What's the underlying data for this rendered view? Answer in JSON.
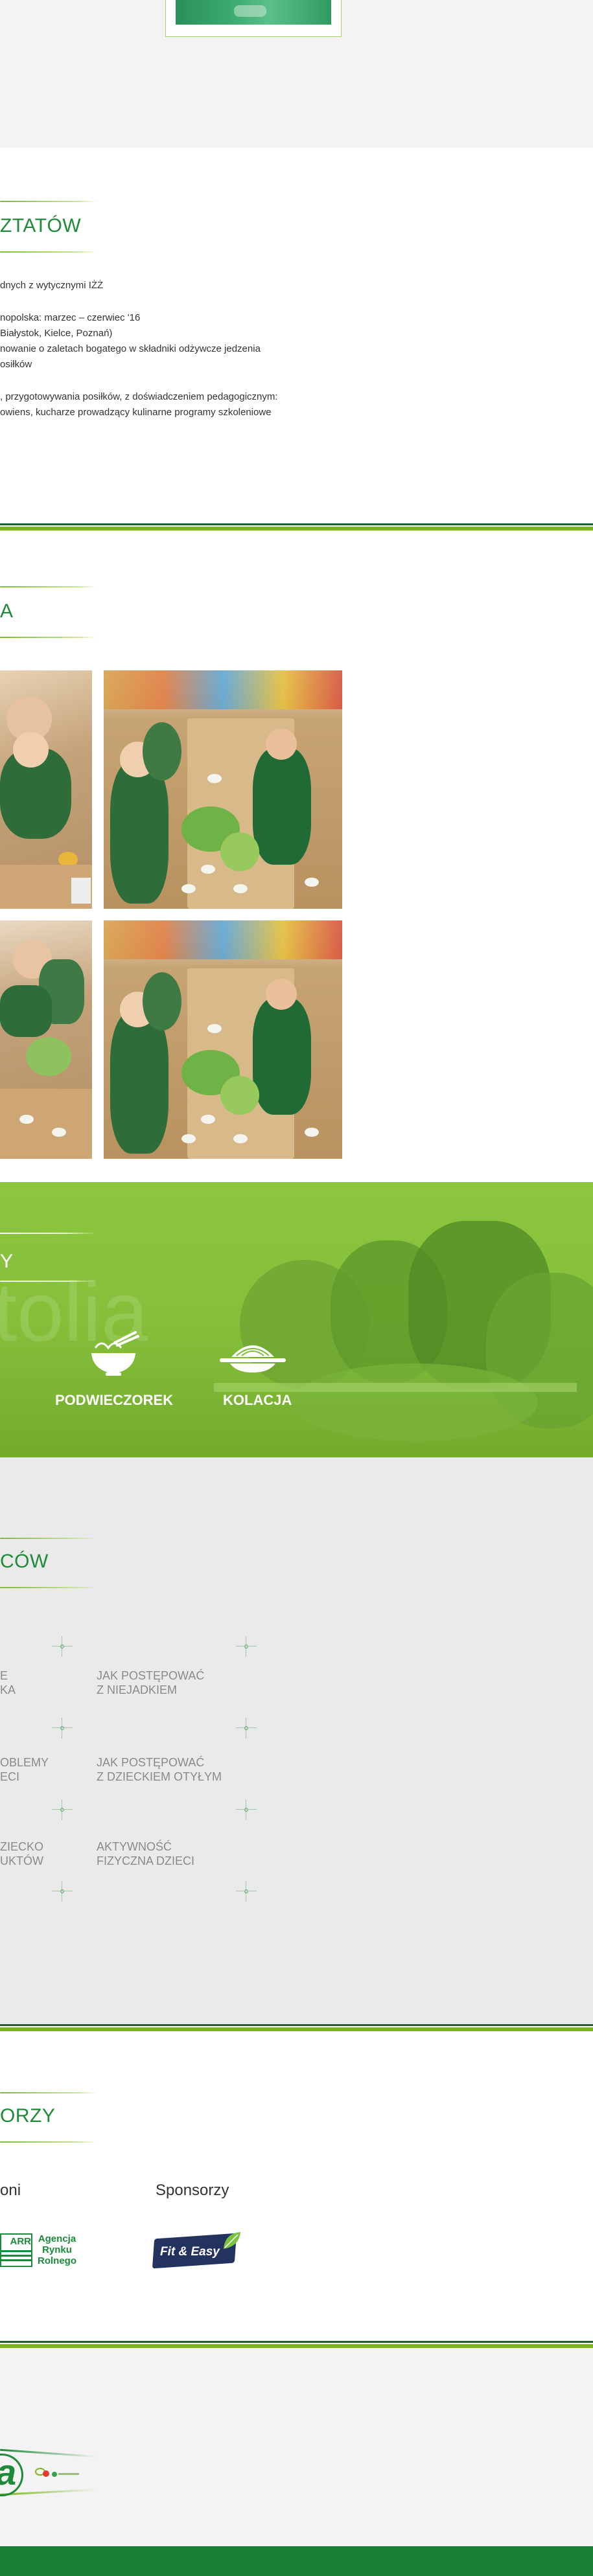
{
  "workshops": {
    "title": "ZTATÓW",
    "lines": [
      "dnych z wytycznymi IŻŻ",
      "nopolska: marzec – czerwiec '16",
      "Białystok, Kielce, Poznań)",
      "nowanie o zaletach bogatego w składniki odżywcze jedzenia",
      "osiłków",
      ", przygotowywania posiłków, z doświadczeniem pedagogicznym:",
      "owiens, kucharze prowadzący kulinarne programy szkoleniowe"
    ]
  },
  "gallery": {
    "title": "A"
  },
  "meals": {
    "title": "Y",
    "watermark": "tolia",
    "items": [
      {
        "label": "PODWIECZOREK",
        "icon": "bowl-noodles-icon"
      },
      {
        "label": "KOLACJA",
        "icon": "plate-spaghetti-icon"
      }
    ]
  },
  "parents": {
    "title": "CÓW",
    "items": [
      {
        "line1": "E",
        "line2": "KA"
      },
      {
        "line1": "JAK POSTĘPOWAĆ",
        "line2": "Z NIEJADKIEM"
      },
      {
        "line1": "OBLEMY",
        "line2": "ECI"
      },
      {
        "line1": "JAK POSTĘPOWAĆ",
        "line2": "Z DZIECKIEM OTYŁYM"
      },
      {
        "line1": "ZIECKO",
        "line2": "UKTÓW"
      },
      {
        "line1": "AKTYWNOŚĆ",
        "line2": "FIZYCZNA DZIECI"
      }
    ]
  },
  "partners": {
    "title": "ORZY",
    "patrons_heading": "oni",
    "sponsors_heading": "Sponsorzy",
    "arr_logo_text": "ARR",
    "arr_name_lines": [
      "Agencja",
      "Rynku",
      "Rolnego"
    ],
    "sponsor_logo_text": "Fit & Easy"
  },
  "footer": {
    "logo_letter": "a"
  },
  "colors": {
    "brand_green": "#1e8a3a",
    "lime": "#7cb51f",
    "meals_bg": "#8cc63f"
  }
}
